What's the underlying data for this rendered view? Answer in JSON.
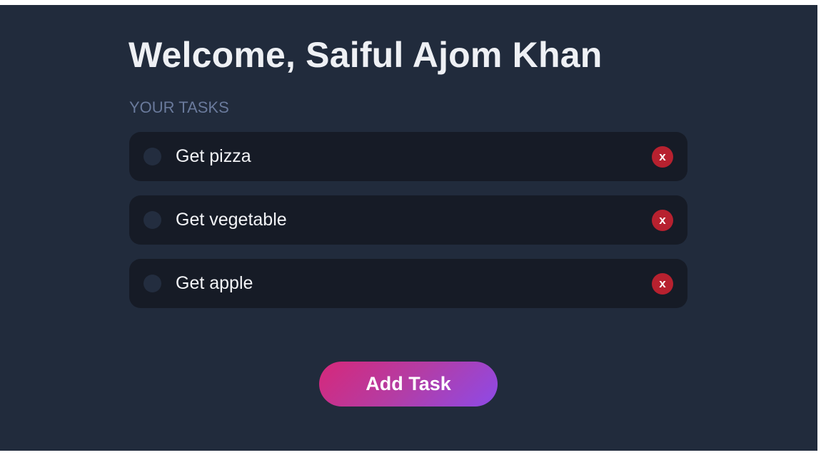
{
  "header": {
    "title": "Welcome, Saiful Ajom Khan"
  },
  "tasks_section": {
    "label": "YOUR TASKS",
    "items": [
      {
        "text": "Get pizza",
        "delete_label": "x",
        "completed": false
      },
      {
        "text": "Get vegetable",
        "delete_label": "x",
        "completed": false
      },
      {
        "text": "Get apple",
        "delete_label": "x",
        "completed": false
      }
    ]
  },
  "actions": {
    "add_task_label": "Add Task"
  },
  "colors": {
    "background": "#212b3c",
    "task_card": "#161b26",
    "delete_button": "#b7212f",
    "add_button_gradient_start": "#d6287a",
    "add_button_gradient_end": "#8d4ae8",
    "section_label": "#6a7a9c"
  },
  "icons": {
    "checkbox": "circle-checkbox-icon",
    "delete": "close-icon"
  }
}
